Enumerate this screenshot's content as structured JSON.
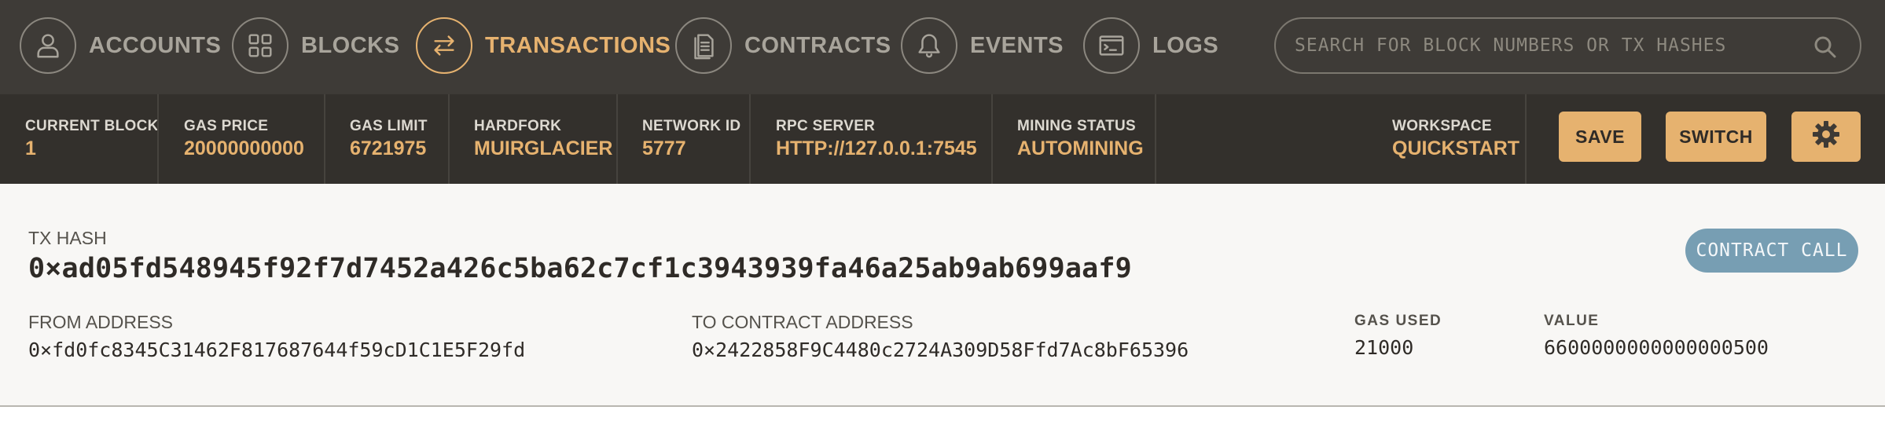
{
  "nav": {
    "items": [
      {
        "label": "ACCOUNTS",
        "icon": "user-icon",
        "active": false
      },
      {
        "label": "BLOCKS",
        "icon": "grid-icon",
        "active": false
      },
      {
        "label": "TRANSACTIONS",
        "icon": "swap-arrows-icon",
        "active": true
      },
      {
        "label": "CONTRACTS",
        "icon": "document-icon",
        "active": false
      },
      {
        "label": "EVENTS",
        "icon": "bell-icon",
        "active": false
      },
      {
        "label": "LOGS",
        "icon": "terminal-icon",
        "active": false
      }
    ],
    "search": {
      "placeholder": "SEARCH FOR BLOCK NUMBERS OR TX HASHES"
    }
  },
  "status": {
    "current_block": {
      "label": "CURRENT BLOCK",
      "value": "1"
    },
    "gas_price": {
      "label": "GAS PRICE",
      "value": "20000000000"
    },
    "gas_limit": {
      "label": "GAS LIMIT",
      "value": "6721975"
    },
    "hardfork": {
      "label": "HARDFORK",
      "value": "MUIRGLACIER"
    },
    "network_id": {
      "label": "NETWORK ID",
      "value": "5777"
    },
    "rpc_server": {
      "label": "RPC SERVER",
      "value": "HTTP://127.0.0.1:7545"
    },
    "mining_status": {
      "label": "MINING STATUS",
      "value": "AUTOMINING"
    },
    "workspace": {
      "label": "WORKSPACE",
      "value": "QUICKSTART"
    },
    "save_label": "SAVE",
    "switch_label": "SWITCH"
  },
  "transaction": {
    "tx_hash_label": "TX HASH",
    "tx_hash": "0×ad05fd548945f92f7d7452a426c5ba62c7cf1c3943939fa46a25ab9ab699aaf9",
    "type_badge": "CONTRACT CALL",
    "from_label": "FROM ADDRESS",
    "from": "0×fd0fc8345C31462F817687644f59cD1C1E5F29fd",
    "to_label": "TO CONTRACT ADDRESS",
    "to": "0×2422858F9C4480c2724A309D58Ffd7Ac8bF65396",
    "gas_used_label": "GAS USED",
    "gas_used": "21000",
    "value_label": "VALUE",
    "value": "6600000000000000500"
  },
  "colors": {
    "accent": "#e6b26f",
    "nav_bg": "#3e3b37",
    "status_bg": "#33302c",
    "badge": "#779eb3"
  }
}
